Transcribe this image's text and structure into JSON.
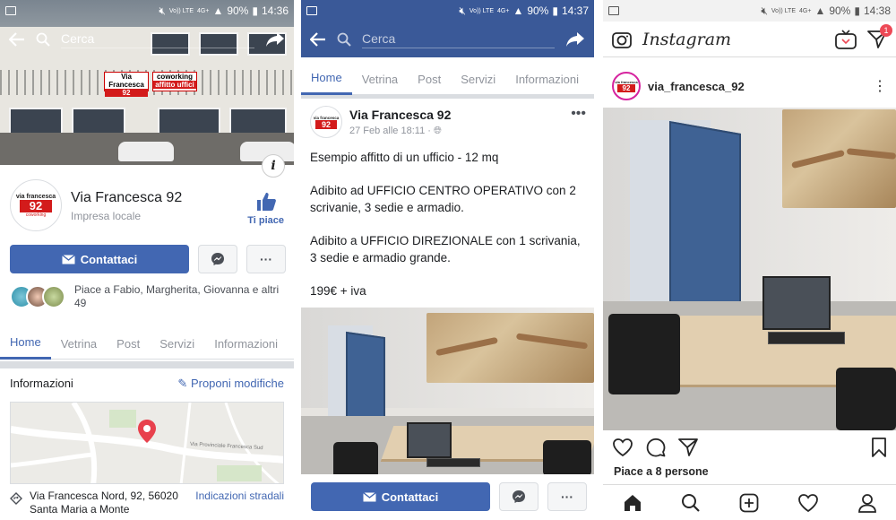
{
  "status": {
    "p1": {
      "battery": "90%",
      "time": "14:36",
      "net": "4G+"
    },
    "p2": {
      "battery": "90%",
      "time": "14:37",
      "net": "4G+"
    },
    "p3": {
      "battery": "90%",
      "time": "14:38",
      "net": "4G+"
    },
    "signal_label": "Vo)) LTE"
  },
  "page": {
    "search_placeholder": "Cerca",
    "cover_banner_left": "Via Francesca",
    "cover_banner_left_num": "92",
    "cover_banner_right": "coworking",
    "cover_banner_right_sub": "affitto uffici",
    "logo_small": "via francesca",
    "logo_num": "92",
    "logo_sub": "coworking",
    "name": "Via Francesca 92",
    "type": "Impresa locale",
    "like_label": "Ti piace",
    "contact_label": "Contattaci",
    "more_label": "···",
    "likers_text": "Piace a Fabio, Margherita, Giovanna e altri 49",
    "tabs": [
      "Home",
      "Vetrina",
      "Post",
      "Servizi",
      "Informazioni"
    ],
    "info_title": "Informazioni",
    "edit_label": "Proponi modifiche",
    "map_road_label": "Via Provinciale Francesca Sud",
    "address": "Via Francesca Nord, 92, 56020 Santa Maria a Monte",
    "directions_label": "Indicazioni stradali"
  },
  "post": {
    "author": "Via Francesca 92",
    "meta": "27 Feb alle 18:11 · ",
    "more": "•••",
    "paragraphs": [
      "Esempio affitto di un ufficio - 12 mq",
      "Adibito ad UFFICIO CENTRO OPERATIVO con 2 scrivanie, 3 sedie e armadio.",
      "Adibito a UFFICIO DIREZIONALE con 1 scrivania, 3 sedie e armadio grande.",
      "199€ + iva"
    ],
    "contact_label": "Contattaci",
    "more_label": "···"
  },
  "instagram": {
    "logo": "Instagram",
    "notification_count": "1",
    "username": "via_francesca_92",
    "more": "⋮",
    "likes_text": "Piace a 8 persone"
  },
  "colors": {
    "facebook_blue": "#3a5998",
    "link_blue": "#4267b2",
    "brand_red": "#d31b1b",
    "ig_badge": "#ed4956"
  },
  "icons": [
    "back-arrow-icon",
    "search-icon",
    "share-icon",
    "info-icon",
    "thumbs-up-icon",
    "envelope-icon",
    "messenger-icon",
    "pencil-icon",
    "map-pin-icon",
    "directions-icon",
    "globe-icon",
    "camera-icon",
    "igtv-icon",
    "direct-icon",
    "heart-icon",
    "comment-icon",
    "send-icon",
    "bookmark-icon",
    "home-icon",
    "plus-square-icon",
    "profile-icon"
  ]
}
